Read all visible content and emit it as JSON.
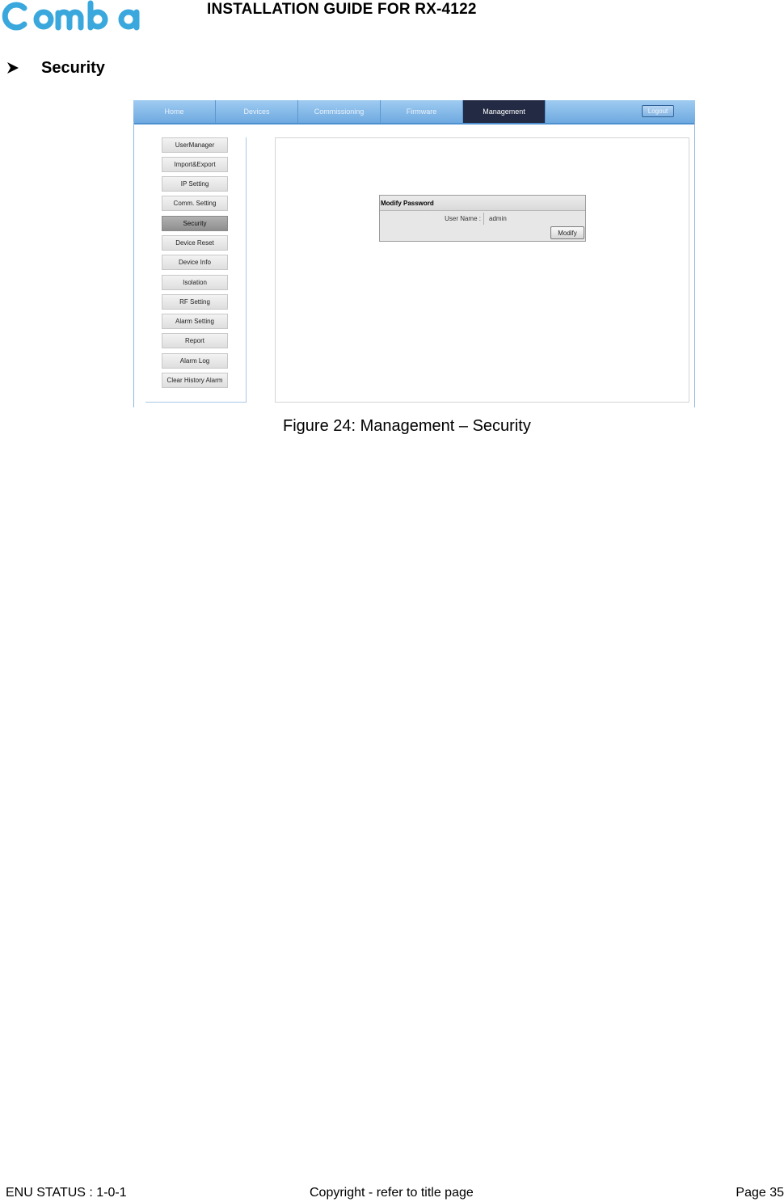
{
  "header": {
    "logo": "Comba",
    "title": "INSTALLATION GUIDE FOR RX-4122",
    "brand_color": "#3aa8dc"
  },
  "section": {
    "bullet_icon": "arrow-bullet-icon",
    "heading": "Security"
  },
  "screenshot": {
    "nav_tabs": [
      {
        "label": "Home",
        "active": false
      },
      {
        "label": "Devices",
        "active": false
      },
      {
        "label": "Commissioning",
        "active": false
      },
      {
        "label": "Firmware",
        "active": false
      },
      {
        "label": "Management",
        "active": true
      }
    ],
    "logout_label": "Logout",
    "sidebar_items": [
      {
        "label": "UserManager",
        "selected": false
      },
      {
        "label": "Import&Export",
        "selected": false
      },
      {
        "label": "IP Setting",
        "selected": false
      },
      {
        "label": "Comm. Setting",
        "selected": false
      },
      {
        "label": "Security",
        "selected": true
      },
      {
        "label": "Device Reset",
        "selected": false
      },
      {
        "label": "Device Info",
        "selected": false
      },
      {
        "label": "Isolation",
        "selected": false
      },
      {
        "label": "RF Setting",
        "selected": false
      },
      {
        "label": "Alarm Setting",
        "selected": false
      },
      {
        "label": "Report",
        "selected": false
      },
      {
        "label": "Alarm Log",
        "selected": false
      },
      {
        "label": "Clear History Alarm",
        "selected": false
      }
    ],
    "panel": {
      "title": "Modify Password",
      "user_name_label": "User Name :",
      "user_name_value": "admin",
      "modify_label": "Modify"
    }
  },
  "caption": "Figure 24: Management – Security",
  "footer": {
    "status": "ENU STATUS : 1-0-1",
    "copyright": "Copyright - refer to title page",
    "page": "Page 35"
  }
}
